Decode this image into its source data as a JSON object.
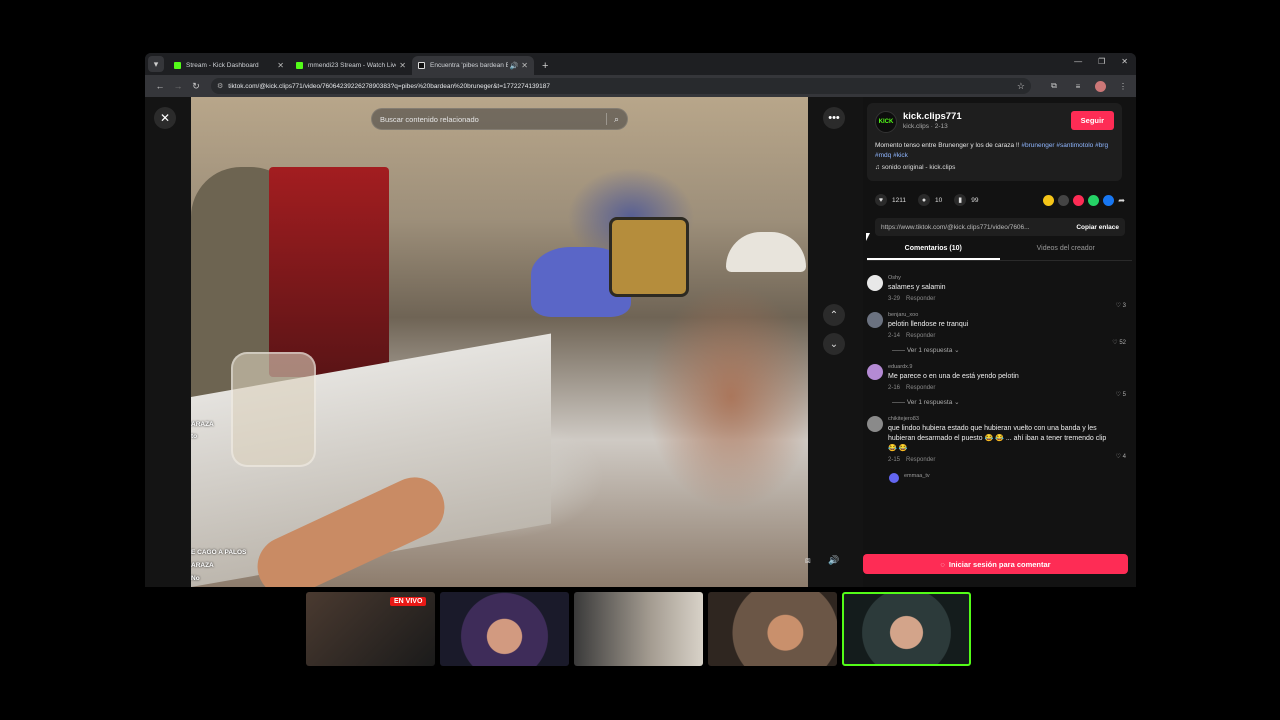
{
  "browser": {
    "tabs": [
      {
        "title": "Stream - Kick Dashboard",
        "favicon": "kick",
        "active": false
      },
      {
        "title": "mmendi23 Stream - Watch Live",
        "favicon": "kick",
        "active": false
      },
      {
        "title": "Encuentra 'pibes bardean B",
        "favicon": "tiktok",
        "active": true
      }
    ],
    "url": "tiktok.com/@kick.clips771/video/7606423922627890383?q=pibes%20bardean%20bruneger&t=1772274139187"
  },
  "video": {
    "search_placeholder": "Buscar contenido relacionado",
    "overlay_lines": [
      "ARAZA",
      "to",
      "E CAGO A PALOS",
      "ARAZA",
      "No"
    ]
  },
  "author": {
    "username": "kick.clips771",
    "subline": "kick.clips · 2-13",
    "avatar_text": "KICK",
    "follow_label": "Seguir",
    "description": "Momento tenso entre Brunenger y los de caraza !!",
    "hashtags": [
      "#brunenger",
      "#santimotolo",
      "#brg",
      "#mdq",
      "#kick"
    ],
    "sound": "sonido original - kick.clips"
  },
  "stats": {
    "likes": "1211",
    "comments": "10",
    "saves": "99"
  },
  "share": {
    "link": "https://www.tiktok.com/@kick.clips771/video/7606...",
    "copy_label": "Copiar enlace",
    "colors": [
      "#f5c518",
      "#444444",
      "#fe2c55",
      "#25d366",
      "#1877f2"
    ]
  },
  "tabs": {
    "comments": "Comentarios (10)",
    "creator": "Videos del creador"
  },
  "comments": [
    {
      "user": "Oshy",
      "text": "salames y salamin",
      "date": "3-29",
      "reply": "Responder",
      "likes": "3",
      "replies": "",
      "avatar": "#e8e8e8"
    },
    {
      "user": "benjaru_xoo",
      "text": "pelotin llendose re tranqui",
      "date": "2-14",
      "reply": "Responder",
      "likes": "52",
      "replies": "Ver 1 respuesta",
      "avatar": "#6b7280"
    },
    {
      "user": "eduardx.9",
      "text": "Me parece o en una de está yendo pelotin",
      "date": "2-16",
      "reply": "Responder",
      "likes": "5",
      "replies": "Ver 1 respuesta",
      "avatar": "#b48ad4"
    },
    {
      "user": "chikitejero83",
      "text": "que lindoo hubiera estado que hubieran vuelto con una banda y les hubieran desarmado el puesto 😂 😂 ... ahí iban a tener tremendo clip 😂 😂",
      "date": "2-15",
      "reply": "Responder",
      "likes": "4",
      "replies": "",
      "avatar": "#8a8a8a"
    },
    {
      "user": "emmaa_tv",
      "text": "",
      "date": "",
      "reply": "",
      "likes": "",
      "replies": "",
      "avatar": "#6366f1"
    }
  ],
  "login_label": "Iniciar sesión para comentar",
  "cams": [
    {
      "live": "EN VIVO",
      "color": "#3a2f2a"
    },
    {
      "live": "",
      "color": "#5a3d7a"
    },
    {
      "live": "",
      "color": "#7d776e"
    },
    {
      "live": "",
      "color": "#6b5646"
    },
    {
      "live": "",
      "color": "#2c3a3a"
    }
  ]
}
